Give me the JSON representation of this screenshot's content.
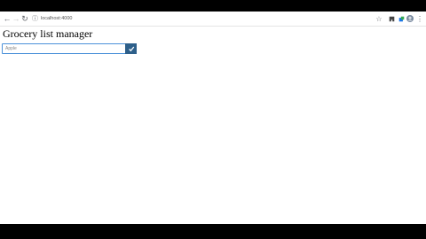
{
  "browser": {
    "url": "localhost:4000",
    "icons": {
      "back": "arrow-left-icon",
      "forward": "arrow-right-icon",
      "reload": "reload-icon",
      "site_info": "info-icon",
      "bookmark": "star-icon",
      "extension": "puzzle-icon",
      "profile": "avatar-icon",
      "menu": "kebab-menu-icon"
    }
  },
  "page": {
    "title": "Grocery list manager",
    "input_placeholder": "Apple",
    "add_button_icon": "check-icon"
  },
  "colors": {
    "button_bg": "#2d5f8a",
    "input_border": "#4a90d9",
    "profile_avatar": "#7a8ba0"
  }
}
